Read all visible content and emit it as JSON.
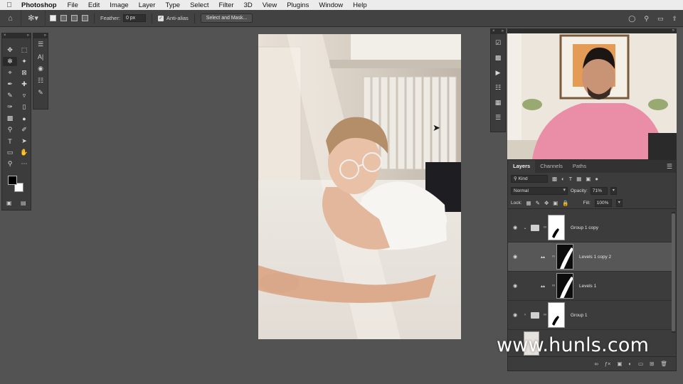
{
  "menubar": {
    "app_name": "Photoshop",
    "items": [
      "File",
      "Edit",
      "Image",
      "Layer",
      "Type",
      "Select",
      "Filter",
      "3D",
      "View",
      "Plugins",
      "Window",
      "Help"
    ]
  },
  "options_bar": {
    "feather_label": "Feather:",
    "feather_value": "0 px",
    "anti_alias_label": "Anti-alias",
    "select_mask_label": "Select and Mask..."
  },
  "layers_panel": {
    "tabs": [
      "Layers",
      "Channels",
      "Paths"
    ],
    "filter_kind": "Kind",
    "blend_mode": "Normal",
    "opacity_label": "Opacity:",
    "opacity_value": "71%",
    "lock_label": "Lock:",
    "fill_label": "Fill:",
    "fill_value": "100%",
    "layers": [
      {
        "name": "Group 1 copy",
        "type": "group",
        "expanded": true
      },
      {
        "name": "Levels 1 copy 2",
        "type": "adjustment",
        "selected": true
      },
      {
        "name": "Levels 1",
        "type": "adjustment"
      },
      {
        "name": "Group 1",
        "type": "group",
        "expanded": false
      }
    ]
  },
  "watermark": "www.hunls.com",
  "colors": {
    "foreground": "#000000",
    "background": "#ffffff",
    "ui_bg": "#535353"
  }
}
